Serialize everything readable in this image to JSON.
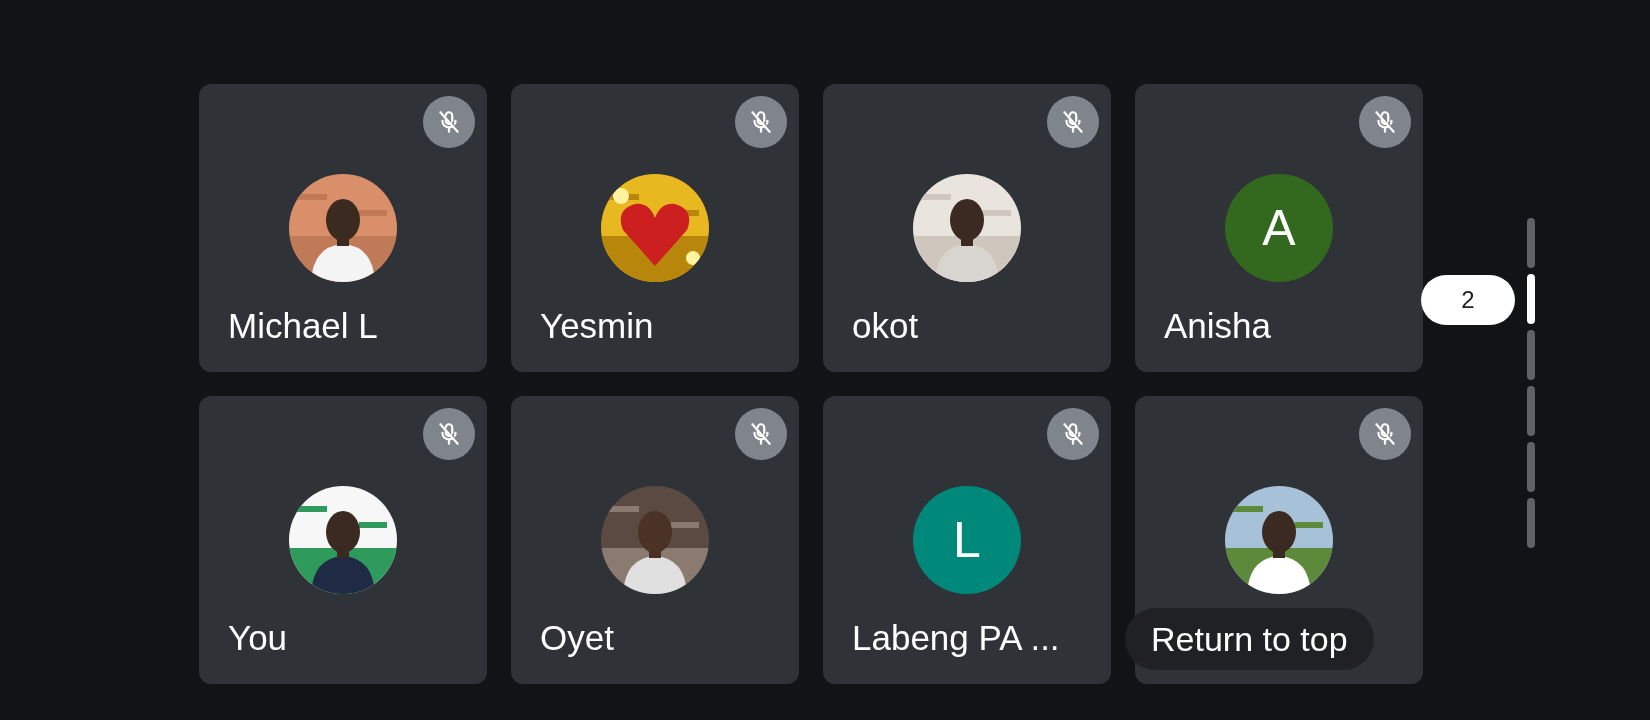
{
  "tiles": [
    {
      "name": "Michael L",
      "muted": true
    },
    {
      "name": "Yesmin",
      "muted": true
    },
    {
      "name": "okot",
      "muted": true
    },
    {
      "name": "Anisha",
      "muted": true,
      "avatar": {
        "kind": "initial",
        "letter": "A",
        "color": "#33691e"
      }
    },
    {
      "name": "You",
      "muted": true
    },
    {
      "name": "Oyet",
      "muted": true
    },
    {
      "name": "Labeng PA ...",
      "muted": true,
      "avatar": {
        "kind": "initial",
        "letter": "L",
        "color": "#00897b"
      }
    },
    {
      "muted": true
    }
  ],
  "page_indicator": "2",
  "pages": [
    {
      "selected": false
    },
    {
      "selected": true
    },
    {
      "selected": false
    },
    {
      "selected": false
    },
    {
      "selected": false
    },
    {
      "selected": false
    }
  ],
  "return_button": "Return to top"
}
